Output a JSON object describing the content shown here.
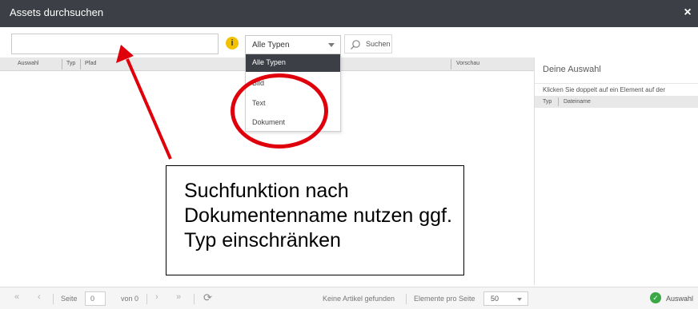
{
  "window": {
    "title": "Assets durchsuchen",
    "close_glyph": "×"
  },
  "search": {
    "value": "",
    "placeholder": "",
    "info_icon_glyph": "i",
    "type_selected": "Alle Typen",
    "button_label": "Suchen"
  },
  "grid": {
    "columns": [
      "Auswahl",
      "Typ",
      "Pfad",
      "Vorschau"
    ]
  },
  "dropdown": {
    "selected": "Alle Typen",
    "options": [
      "Bild",
      "Text",
      "Dokument"
    ]
  },
  "selection_panel": {
    "title": "Deine Auswahl",
    "hint": "Klicken Sie doppelt auf ein Element auf der",
    "columns": [
      "Typ",
      "Dateiname"
    ]
  },
  "pagination": {
    "first_glyph": "«",
    "prev_glyph": "‹",
    "page_label": "Seite",
    "page_value": "0",
    "of_label": "von 0",
    "next_glyph": "›",
    "last_glyph": "»",
    "refresh_glyph": "⟳",
    "status": "Keine Artikel gefunden",
    "per_page_label": "Elemente pro Seite",
    "per_page_value": "50",
    "select_button_label": "Auswahl",
    "check_glyph": "✓"
  },
  "annotation": {
    "callout_lines": [
      "Suchfunktion nach",
      "Dokumentenname nutzen ggf.",
      "Typ einschränken"
    ]
  },
  "colors": {
    "titlebar": "#3c3f45",
    "annotation_red": "#e0000c",
    "info_yellow": "#f2c200",
    "confirm_green": "#3aa845"
  },
  "icons": {
    "info": "info-icon",
    "search": "search-icon",
    "refresh": "refresh-icon",
    "check": "check-icon",
    "close": "close-icon"
  }
}
